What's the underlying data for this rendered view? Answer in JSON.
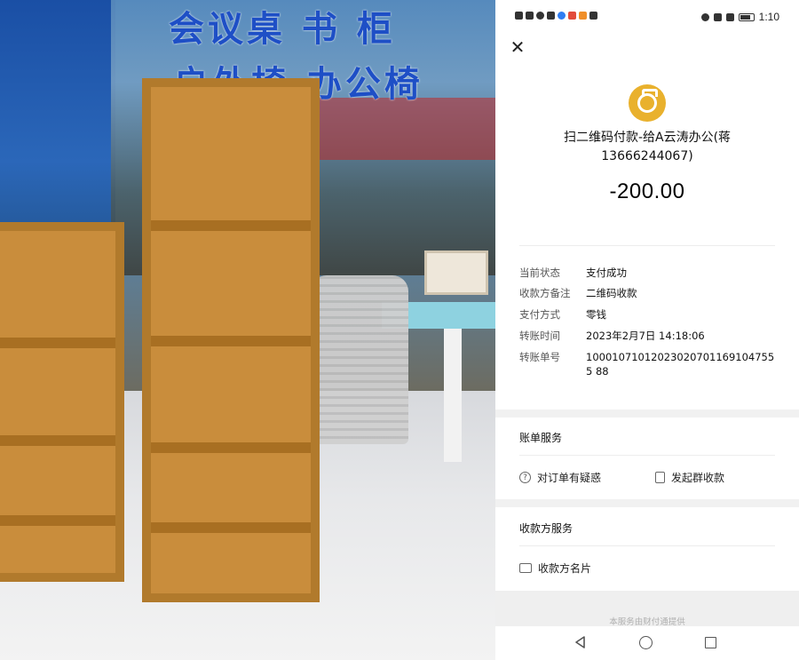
{
  "photo": {
    "sign_line1": "会议桌  书  柜",
    "sign_line2": "户外椅    办公椅"
  },
  "status_bar": {
    "time": "1:10"
  },
  "receipt": {
    "merchant_title": "扫二维码付款-给A云涛办公(蒋13666244067)",
    "amount": "-200.00",
    "details": [
      {
        "label": "当前状态",
        "value": "支付成功"
      },
      {
        "label": "收款方备注",
        "value": "二维码收款"
      },
      {
        "label": "支付方式",
        "value": "零钱"
      },
      {
        "label": "转账时间",
        "value": "2023年2月7日 14:18:06"
      },
      {
        "label": "转账单号",
        "value": "100010710120230207011691047555 88"
      }
    ]
  },
  "bill_services": {
    "title": "账单服务",
    "question_label": "对订单有疑惑",
    "group_collect_label": "发起群收款"
  },
  "payee_services": {
    "title": "收款方服务",
    "card_label": "收款方名片"
  },
  "footer": {
    "provider_text": "本服务由财付通提供"
  },
  "icons": {
    "close": "close-icon",
    "medal": "money-bag-icon",
    "question": "question-circle-icon",
    "group_collect": "receipt-icon",
    "card": "business-card-icon"
  },
  "colors": {
    "medal": "#e9b12d",
    "sign_text": "#1e4fc6"
  }
}
